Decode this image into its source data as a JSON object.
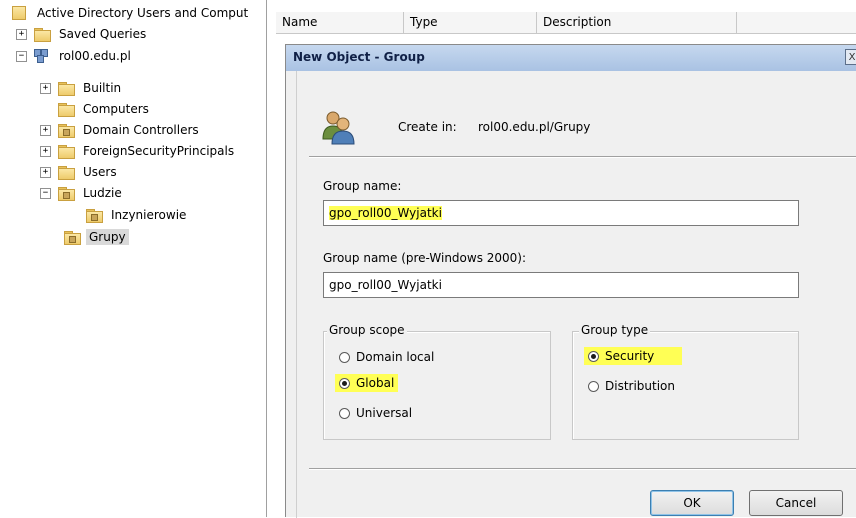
{
  "tree": {
    "root": "Active Directory Users and Comput",
    "saved_queries": "Saved Queries",
    "domain": "rol00.edu.pl",
    "children": [
      {
        "label": "Builtin",
        "expander": "+"
      },
      {
        "label": "Computers",
        "expander": ""
      },
      {
        "label": "Domain Controllers",
        "expander": "+"
      },
      {
        "label": "ForeignSecurityPrincipals",
        "expander": "+"
      },
      {
        "label": "Users",
        "expander": "+"
      },
      {
        "label": "Ludzie",
        "expander": "−"
      }
    ],
    "ludzie_child": "Inzynierowie",
    "selected": "Grupy",
    "expander_plus": "+",
    "expander_minus": "−"
  },
  "list": {
    "columns": [
      "Name",
      "Type",
      "Description"
    ]
  },
  "dialog": {
    "title": "New Object - Group",
    "close": "X",
    "create_in_label": "Create in:",
    "create_in_value": "rol00.edu.pl/Grupy",
    "group_name_label": "Group name:",
    "group_name_value": "gpo_roll00_Wyjatki",
    "pre2000_label": "Group name (pre-Windows 2000):",
    "pre2000_value": "gpo_roll00_Wyjatki",
    "scope": {
      "title": "Group scope",
      "options": [
        "Domain local",
        "Global",
        "Universal"
      ],
      "selected": "Global"
    },
    "type": {
      "title": "Group type",
      "options": [
        "Security",
        "Distribution"
      ],
      "selected": "Security"
    },
    "ok_label": "OK",
    "cancel_label": "Cancel",
    "highlight_color": "#ffff55"
  }
}
